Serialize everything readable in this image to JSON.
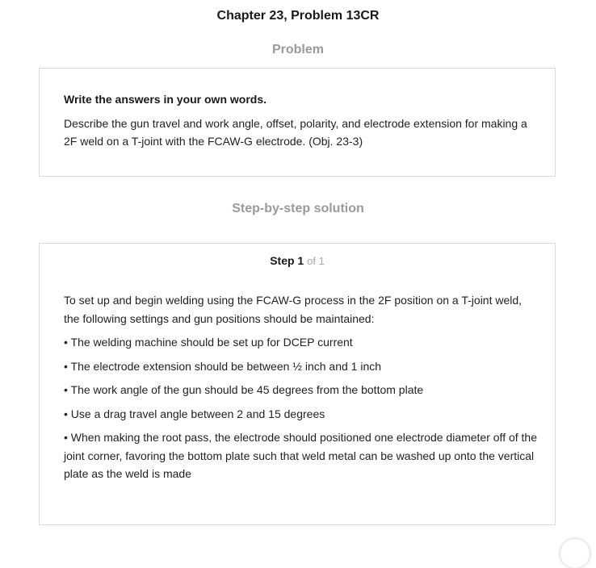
{
  "page_title": "Chapter 23, Problem 13CR",
  "problem": {
    "heading": "Problem",
    "instruction": "Write the answers in your own words.",
    "question": "Describe the gun travel and work angle, offset, polarity, and electrode extension for making a 2F weld on a T-joint with the FCAW-G electrode. (Obj. 23-3)"
  },
  "solution": {
    "heading": "Step-by-step solution",
    "step_word": "Step",
    "step_current": "1",
    "step_total_text": "of 1",
    "intro": "To set up and begin welding using the FCAW-G process in the 2F position on a T-joint weld, the following settings and gun positions should be maintained:",
    "items": [
      "• The welding machine should be set up for DCEP current",
      "• The electrode extension should be between ½ inch and 1 inch",
      "• The work angle of the gun should be 45 degrees from the bottom plate",
      "• Use a drag travel angle between 2 and 15 degrees",
      "• When making the root pass, the electrode should positioned one electrode diameter off of the joint corner, favoring the bottom plate such that weld metal can be washed up onto the vertical plate as the weld is made"
    ]
  }
}
